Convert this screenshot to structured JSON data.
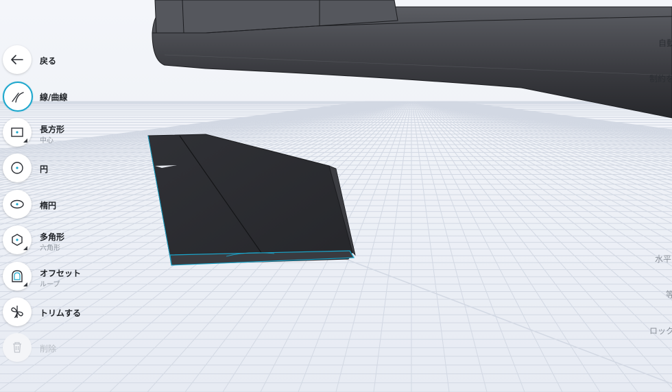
{
  "toolbar": {
    "back": {
      "label": "戻る",
      "icon": "arrow-left-icon"
    },
    "line": {
      "label": "線/曲線",
      "icon": "line-curve-icon"
    },
    "rect": {
      "label": "長方形",
      "sub": "中心",
      "icon": "rectangle-icon"
    },
    "circle": {
      "label": "円",
      "icon": "circle-icon"
    },
    "ellipse": {
      "label": "楕円",
      "icon": "ellipse-icon"
    },
    "polygon": {
      "label": "多角形",
      "sub": "六角形",
      "icon": "hexagon-icon"
    },
    "offset": {
      "label": "オフセット",
      "sub": "ループ",
      "icon": "offset-icon"
    },
    "trim": {
      "label": "トリムする",
      "icon": "trim-icon"
    },
    "delete": {
      "label": "削除",
      "icon": "trash-icon"
    }
  },
  "right_panel": {
    "auto": "自動",
    "constraint": "制約を",
    "horizontal": "水平",
    "equal": "等",
    "lock": "ロック"
  },
  "colors": {
    "accent": "#1aa6cc",
    "model": "#2f3035",
    "grid": "#cfd5e0"
  }
}
